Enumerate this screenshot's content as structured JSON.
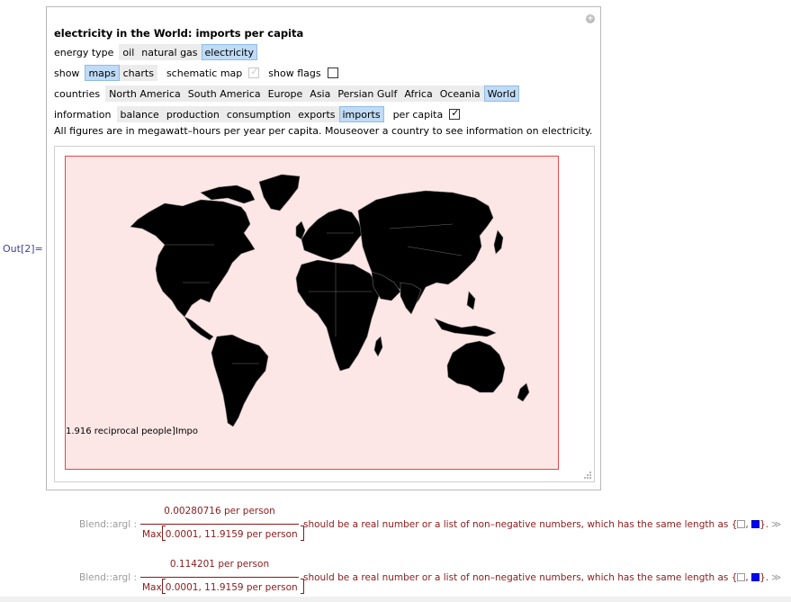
{
  "cell": {
    "out_label": "Out[2]="
  },
  "panel": {
    "title": "electricity in the World: imports per capita",
    "energy_type": {
      "label": "energy type",
      "options": [
        "oil",
        "natural gas",
        "electricity"
      ],
      "selected": "electricity"
    },
    "show": {
      "label": "show",
      "options": [
        "maps",
        "charts"
      ],
      "selected": "maps",
      "schematic_map_label": "schematic map",
      "schematic_map_checked": true,
      "schematic_map_enabled": false,
      "show_flags_label": "show flags",
      "show_flags_checked": false
    },
    "countries": {
      "label": "countries",
      "options": [
        "North America",
        "South America",
        "Europe",
        "Asia",
        "Persian Gulf",
        "Africa",
        "Oceania",
        "World"
      ],
      "selected": "World"
    },
    "information": {
      "label": "information",
      "options": [
        "balance",
        "production",
        "consumption",
        "exports",
        "imports"
      ],
      "selected": "imports",
      "per_capita_label": "per capita",
      "per_capita_checked": true
    },
    "note": "All figures are in megawatt–hours per year per capita. Mouseover a country to see information on electricity.",
    "map": {
      "legend_text": "1.916 reciprocal people]Impo",
      "background_color": "#fde6e6",
      "border_color": "#e04a4a",
      "land_color": "#000000",
      "border_line_color": "#777777"
    }
  },
  "messages": [
    {
      "head": "Blend::argl :",
      "numerator": "0.00280716 per person",
      "den_fn": "Max",
      "den_args": "0.0001,  11.9159 per person",
      "text": "should be a real number or a list of non–negative numbers, which has the same length as {",
      "sep": ", ",
      "end": "}.",
      "more": "≫"
    },
    {
      "head": "Blend::argl :",
      "numerator": "0.114201 per person",
      "den_fn": "Max",
      "den_args": "0.0001,  11.9159 per person",
      "text": "should be a real number or a list of non–negative numbers, which has the same length as {",
      "sep": ", ",
      "end": "}.",
      "more": "≫"
    }
  ]
}
